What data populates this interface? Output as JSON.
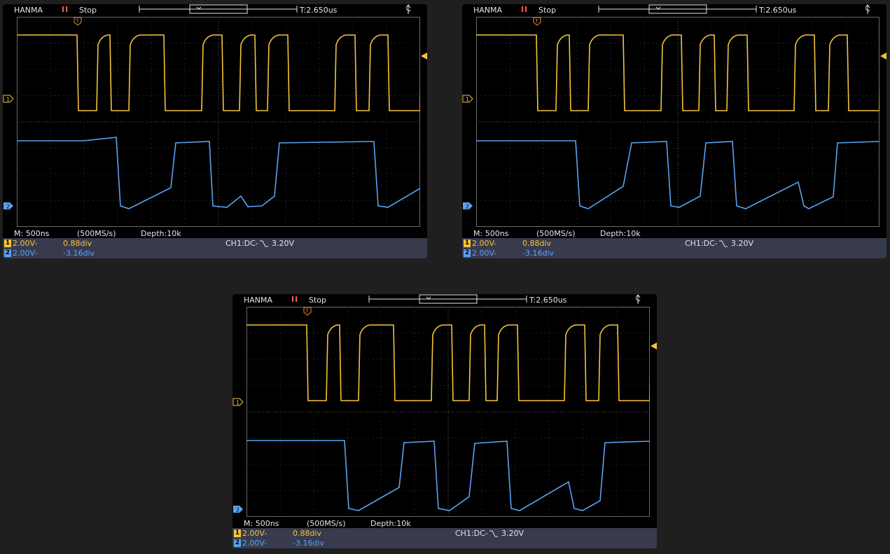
{
  "colors": {
    "background": "#1f1f1f",
    "screen": "#000000",
    "ch1": "#f5c33b",
    "ch2": "#5aa2f0",
    "panel": "#383b4e",
    "run_indicator": "#ff5b4f"
  },
  "icons": [
    "pause-icon",
    "trigger-position-icon",
    "usb-icon",
    "trigger-level-marker-icon",
    "ch1-ground-marker-icon",
    "ch2-ground-marker-icon",
    "trigger-edge-falling-icon"
  ],
  "screens": [
    {
      "brand": "HANMA",
      "run_state": "Stop",
      "trigger_time": "T:2.650us",
      "trigger_pos_label": "T",
      "timebase": "M: 500ns",
      "sample_rate": "(500MS/s)",
      "depth": "Depth:10k",
      "ch1": {
        "num": "1",
        "scale": "2.00V-",
        "offset": "0.88div"
      },
      "ch2": {
        "num": "2",
        "scale": "2.00V-",
        "offset": "-3.16div"
      },
      "trigger": {
        "prefix": "CH1:DC-",
        "level": "3.20V"
      },
      "ch2_trace_levels": [
        0.0,
        0.1,
        1.0,
        0.62,
        0.0,
        0.0,
        0.9,
        0.75,
        0.97,
        0.97,
        0.0,
        0.1,
        0.0,
        0.84,
        0.0,
        0.1,
        0.0,
        0.95,
        0.0,
        0.75
      ]
    },
    {
      "brand": "HANMA",
      "run_state": "Stop",
      "trigger_time": "T:2.650us",
      "trigger_pos_label": "T",
      "timebase": "M: 500ns",
      "sample_rate": "(500MS/s)",
      "depth": "Depth:10k",
      "ch1": {
        "num": "1",
        "scale": "2.00V-",
        "offset": "0.88div"
      },
      "ch2": {
        "num": "2",
        "scale": "2.00V-",
        "offset": "-3.16div"
      },
      "trigger": {
        "prefix": "CH1:DC-",
        "level": "3.20V"
      }
    },
    {
      "brand": "HANMA",
      "run_state": "Stop",
      "trigger_time": "T:2.650us",
      "trigger_pos_label": "T",
      "timebase": "M: 500ns",
      "sample_rate": "(500MS/s)",
      "depth": "Depth:10k",
      "ch1": {
        "num": "1",
        "scale": "2.00V-",
        "offset": "0.88div"
      },
      "ch2": {
        "num": "2",
        "scale": "2.00V-",
        "offset": "-3.16div"
      },
      "trigger": {
        "prefix": "CH1:DC-",
        "level": "3.20V"
      }
    }
  ]
}
